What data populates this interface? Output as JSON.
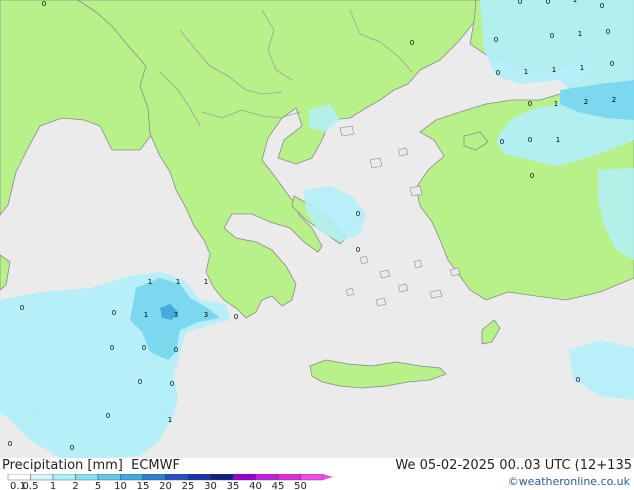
{
  "title": "Precipitation [mm]",
  "model": "ECMWF",
  "valid_time": "We 05-02-2025 00..03 UTC (12+135",
  "credit": "©weatheronline.co.uk",
  "colors": {
    "sea": "#ebebeb",
    "land": "#b8f08a",
    "coast": "#8c8c8c",
    "border": "#a0a0a0",
    "precip_light": "#b0f0f8",
    "precip_medium": "#7cd8ee",
    "precip_strong": "#48a8e0"
  },
  "legend": {
    "ticks": [
      "0.1",
      "0.5",
      "1",
      "2",
      "5",
      "10",
      "15",
      "20",
      "25",
      "30",
      "35",
      "40",
      "45",
      "50"
    ],
    "colors": [
      "#ffffff",
      "#d4f6fa",
      "#aaeef6",
      "#82e0f2",
      "#5ccaee",
      "#3ca8e4",
      "#2d7fd6",
      "#2153c6",
      "#1535a8",
      "#0f1f88",
      "#9a00d2",
      "#c020e0",
      "#dc2edc",
      "#f04ae8"
    ]
  },
  "labels": [
    {
      "text": "0"
    },
    {
      "text": "0"
    },
    {
      "text": "0"
    },
    {
      "text": "1"
    },
    {
      "text": "0"
    },
    {
      "text": "0"
    },
    {
      "text": "0"
    },
    {
      "text": "0"
    },
    {
      "text": "1"
    },
    {
      "text": "0"
    },
    {
      "text": "0"
    },
    {
      "text": "1"
    },
    {
      "text": "1"
    },
    {
      "text": "1"
    },
    {
      "text": "0"
    },
    {
      "text": "0"
    },
    {
      "text": "1"
    },
    {
      "text": "2"
    },
    {
      "text": "2"
    },
    {
      "text": "0"
    },
    {
      "text": "0"
    },
    {
      "text": "0"
    },
    {
      "text": "1"
    },
    {
      "text": "0"
    },
    {
      "text": "0"
    },
    {
      "text": "0"
    },
    {
      "text": "1"
    },
    {
      "text": "1"
    },
    {
      "text": "1"
    },
    {
      "text": "0"
    },
    {
      "text": "1"
    },
    {
      "text": "3"
    },
    {
      "text": "3"
    },
    {
      "text": "0"
    },
    {
      "text": "0"
    },
    {
      "text": "0"
    },
    {
      "text": "0"
    },
    {
      "text": "0"
    },
    {
      "text": "0"
    },
    {
      "text": "1"
    },
    {
      "text": "0"
    },
    {
      "text": "0"
    },
    {
      "text": "0"
    },
    {
      "text": "0"
    }
  ]
}
